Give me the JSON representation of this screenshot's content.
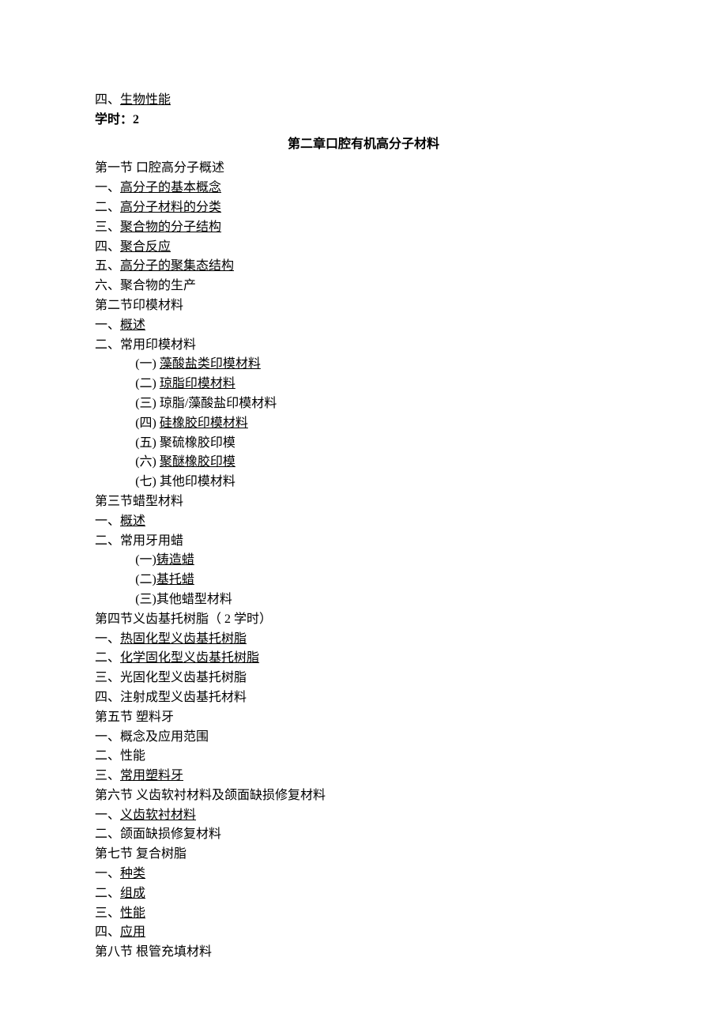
{
  "prelude": {
    "item4_prefix": "四、",
    "item4_text": "生物性能",
    "hours_label": "学时：",
    "hours_value": "2"
  },
  "chapter2_title": "第二章口腔有机高分子材料",
  "s1": {
    "header": "第一节 口腔高分子概述",
    "i1_p": "一、",
    "i1_t": "高分子的基本概念",
    "i2_p": "二、",
    "i2_t": "高分子材料的分类",
    "i3_p": "三、",
    "i3_t": "聚合物的分子结构",
    "i4_p": "四、",
    "i4_t": "聚合反应",
    "i5_p": "五、",
    "i5_t": "高分子的聚集态结构",
    "i6": "六、聚合物的生产"
  },
  "s2": {
    "header": "第二节印模材料",
    "i1_p": "一、",
    "i1_t": "概述",
    "i2": "二、常用印模材料",
    "sub1_p": "(一) ",
    "sub1_t": "藻酸盐类印模材料",
    "sub2_p": "(二) ",
    "sub2_t": "琼脂印模材料",
    "sub3": "(三) 琼脂/藻酸盐印模材料",
    "sub4_p": "(四) ",
    "sub4_t": "硅橡胶印模材料",
    "sub5": "(五) 聚硫橡胶印模",
    "sub6_p": "(六) ",
    "sub6_t": "聚醚橡胶印模",
    "sub7": "(七) 其他印模材料"
  },
  "s3": {
    "header": "第三节蜡型材料",
    "i1_p": "一、",
    "i1_t": "概述",
    "i2": "二、常用牙用蜡",
    "sub1_p": "(一)",
    "sub1_t": "铸造蜡",
    "sub2_p": "(二)",
    "sub2_t": "基托蜡",
    "sub3": "(三)其他蜡型材料"
  },
  "s4": {
    "header": "第四节义齿基托树脂（ 2 学时）",
    "i1_p": "一、",
    "i1_t": "热固化型义齿基托树脂",
    "i2_p": "二、",
    "i2_t": "化学固化型义齿基托树脂",
    "i3": "三、光固化型义齿基托树脂",
    "i4": "四、注射成型义齿基托材料"
  },
  "s5": {
    "header": "第五节 塑料牙",
    "i1": "一、概念及应用范围",
    "i2": "二、性能",
    "i3_p": "三、",
    "i3_t": "常用塑料牙"
  },
  "s6": {
    "header": "第六节 义齿软衬材料及颌面缺损修复材料",
    "i1_p": "一、",
    "i1_t": "义齿软衬材料",
    "i2": "二、颌面缺损修复材料"
  },
  "s7": {
    "header": "第七节 复合树脂",
    "i1_p": "一、",
    "i1_t": "种类",
    "i2_p": "二、",
    "i2_t": "组成",
    "i3_p": "三、",
    "i3_t": "性能",
    "i4_p": "四、",
    "i4_t": "应用"
  },
  "s8": {
    "header": "第八节 根管充填材料"
  }
}
